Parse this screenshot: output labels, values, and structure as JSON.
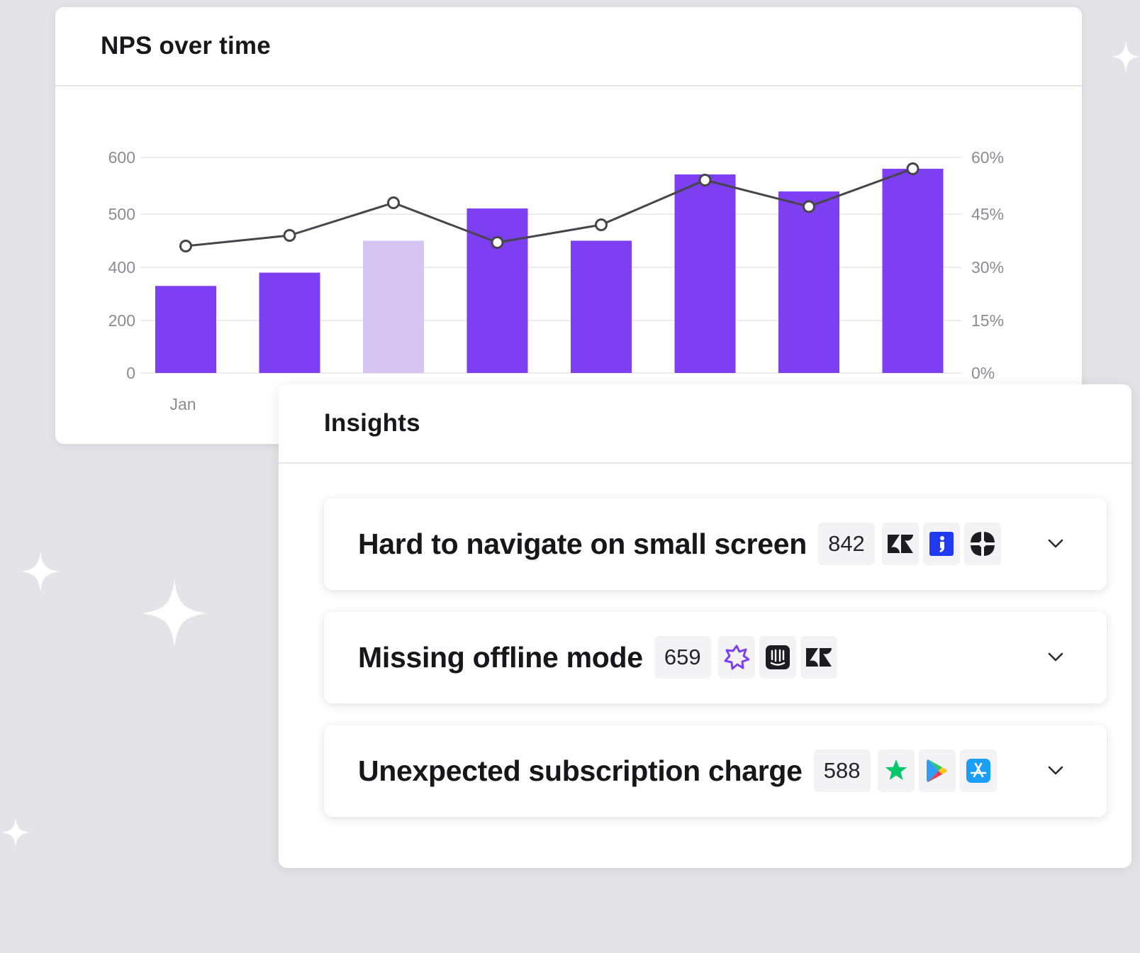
{
  "chart_card": {
    "title": "NPS over time"
  },
  "chart_data": {
    "type": "bar",
    "title": "NPS over time",
    "categories": [
      "Jan",
      "",
      "",
      "",
      "",
      "",
      "",
      ""
    ],
    "left_axis_ticks": [
      "600",
      "500",
      "400",
      "200",
      "0"
    ],
    "right_axis_ticks": [
      "60%",
      "45%",
      "30%",
      "15%",
      "0%"
    ],
    "series": [
      {
        "type": "bar",
        "values": [
          330,
          380,
          450,
          510,
          450,
          570,
          540,
          580
        ],
        "highlight_index": 2
      },
      {
        "type": "line",
        "axis": "right",
        "values": [
          36,
          39,
          48,
          37,
          42,
          54,
          47,
          57
        ]
      }
    ],
    "colors": {
      "bar": "#7e3ff2",
      "bar_highlight": "#d6c5f3",
      "line": "#45454b"
    },
    "grid": true
  },
  "insights": {
    "title": "Insights",
    "items": [
      {
        "title": "Hard to navigate on small screen",
        "count": "842",
        "sources": [
          "zendesk-icon",
          "intercom-icon",
          "qualtrics-icon"
        ]
      },
      {
        "title": "Missing offline mode",
        "count": "659",
        "sources": [
          "burst-icon",
          "intercom-icon",
          "zendesk-icon"
        ]
      },
      {
        "title": "Unexpected subscription charge",
        "count": "588",
        "sources": [
          "trustpilot-star-icon",
          "google-play-icon",
          "app-store-icon"
        ]
      }
    ]
  },
  "colors": {
    "background": "#e4e4e8",
    "accent": "#7e3ff2"
  }
}
